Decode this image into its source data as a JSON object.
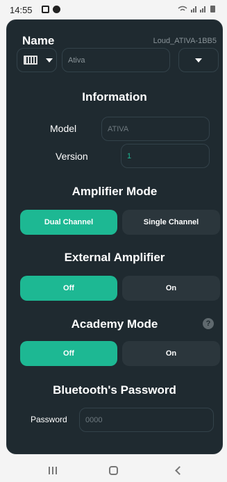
{
  "status_bar": {
    "time": "14:55",
    "right_icons": "wifi-icon signal-icon signal-icon battery-icon"
  },
  "header": {
    "name_title": "Name",
    "device_id": "Loud_ATIVA-1BB5",
    "icon_select": "film-icon",
    "name_value": "Ativa"
  },
  "information": {
    "title": "Information",
    "model_label": "Model",
    "model_value": "ATIVA",
    "version_label": "Version",
    "version_value": "1"
  },
  "amplifier_mode": {
    "title": "Amplifier Mode",
    "options": [
      "Dual Channel",
      "Single Channel"
    ],
    "selected": "Dual Channel"
  },
  "external_amplifier": {
    "title": "External Amplifier",
    "options": [
      "Off",
      "On"
    ],
    "selected": "Off"
  },
  "academy_mode": {
    "title": "Academy Mode",
    "help_icon": "?",
    "options": [
      "Off",
      "On"
    ],
    "selected": "Off"
  },
  "bluetooth": {
    "title": "Bluetooth's Password",
    "password_label": "Password",
    "password_value": "0000"
  },
  "colors": {
    "panel": "#1f2a30",
    "accent": "#1db893",
    "segment_off": "#2b363c"
  }
}
